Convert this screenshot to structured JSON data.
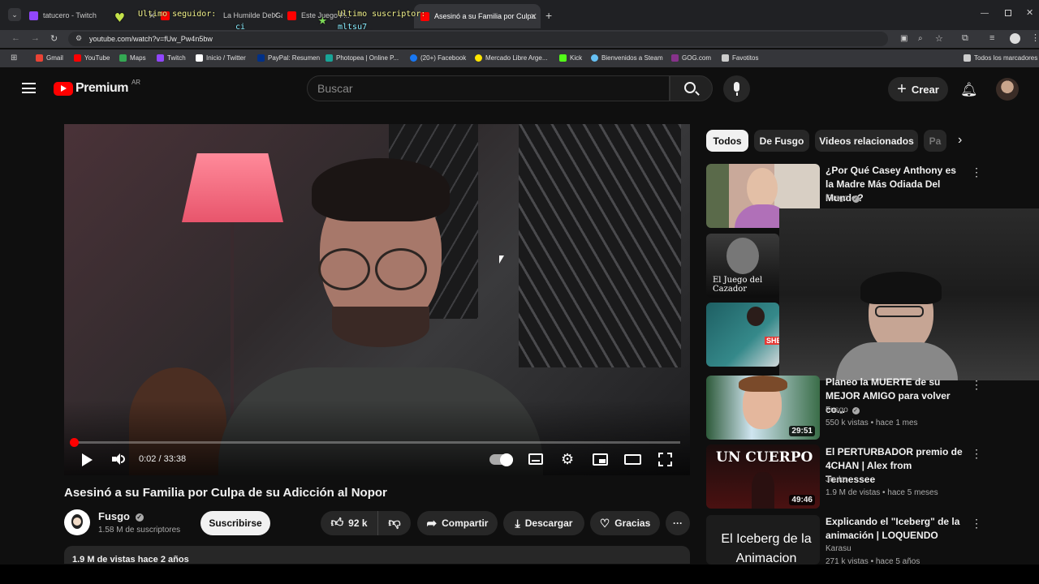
{
  "browser": {
    "tabs": [
      {
        "label": "tatucero - Twitch",
        "color": "#9146ff"
      },
      {
        "label": "La Humilde Del Gamin",
        "color": "#ff0000"
      },
      {
        "label": "Este Juego P...",
        "color": "#ff0000"
      },
      {
        "label": "Asesinó a su Familia por Culpa",
        "color": "#ff0000"
      }
    ],
    "url": "youtube.com/watch?v=fUw_Pw4n5bw",
    "bookmarks": [
      {
        "label": "Gmail",
        "color": "#ea4335"
      },
      {
        "label": "YouTube",
        "color": "#ff0000"
      },
      {
        "label": "Maps",
        "color": "#34a853"
      },
      {
        "label": "Twitch",
        "color": "#9146ff"
      },
      {
        "label": "Inicio / Twitter",
        "color": "#ffffff"
      },
      {
        "label": "PayPal: Resumen",
        "color": "#003087"
      },
      {
        "label": "Photopea | Online P...",
        "color": "#18a497"
      },
      {
        "label": "(20+) Facebook",
        "color": "#1877f2"
      },
      {
        "label": "Mercado Libre Arge...",
        "color": "#ffe600"
      },
      {
        "label": "Kick",
        "color": "#53fc18"
      },
      {
        "label": "Bienvenidos a Steam",
        "color": "#66c0f4"
      },
      {
        "label": "GOG.com",
        "color": "#86328a"
      },
      {
        "label": "Favotitos",
        "color": "#cccccc"
      }
    ],
    "all_bookmarks": "Todos los marcadores"
  },
  "stream_overlay": {
    "follower_label": "Ultimo seguidor:",
    "follower_name": "ci",
    "subscriber_label": "Ultimo suscriptor:",
    "subscriber_name": "mltsu7_"
  },
  "youtube": {
    "logo": "Premium",
    "region": "AR",
    "search_placeholder": "Buscar",
    "create_label": "Crear",
    "player": {
      "time": "0:02 / 33:38",
      "progress": 0.001
    },
    "video": {
      "title": "Asesinó a su Familia por Culpa de su Adicción al Nopor",
      "channel": "Fusgo",
      "subscribers": "1.58 M de suscriptores",
      "subscribe_label": "Suscribirse",
      "likes": "92 k",
      "share_label": "Compartir",
      "download_label": "Descargar",
      "thanks_label": "Gracias",
      "views_line": "1.9 M de vistas  hace 2 años"
    },
    "chips": [
      "Todos",
      "De Fusgo",
      "Videos relacionados",
      "Pa"
    ],
    "related": [
      {
        "title": "¿Por Qué Casey Anthony es la Madre Más Odiada Del Mundo?",
        "channel": "Fusgo",
        "meta": "",
        "duration": ""
      },
      {
        "title": "",
        "channel": "",
        "meta": "",
        "duration": "",
        "thumb_text": "El Juego del Cazador"
      },
      {
        "title": "",
        "channel": "",
        "meta": "",
        "duration": "",
        "thumb_text": "SHE"
      },
      {
        "title": "Planeo la MUERTE de su MEJOR AMIGO para volver co...",
        "channel": "Fusgo",
        "meta": "550 k vistas • hace 1 mes",
        "duration": "29:51"
      },
      {
        "title": "El PERTURBADOR premio de 4CHAN | Alex from Tennessee",
        "channel": "Jouka",
        "meta": "1.9 M de vistas • hace 5 meses",
        "duration": "49:46",
        "thumb_text": "UN CUERPO"
      },
      {
        "title": "Explicando el \"Iceberg\" de la animación | LOQUENDO",
        "channel": "Karasu",
        "meta": "271 k vistas • hace 5 años",
        "duration": "",
        "thumb_text": "El Iceberg de la Animacion"
      }
    ]
  }
}
